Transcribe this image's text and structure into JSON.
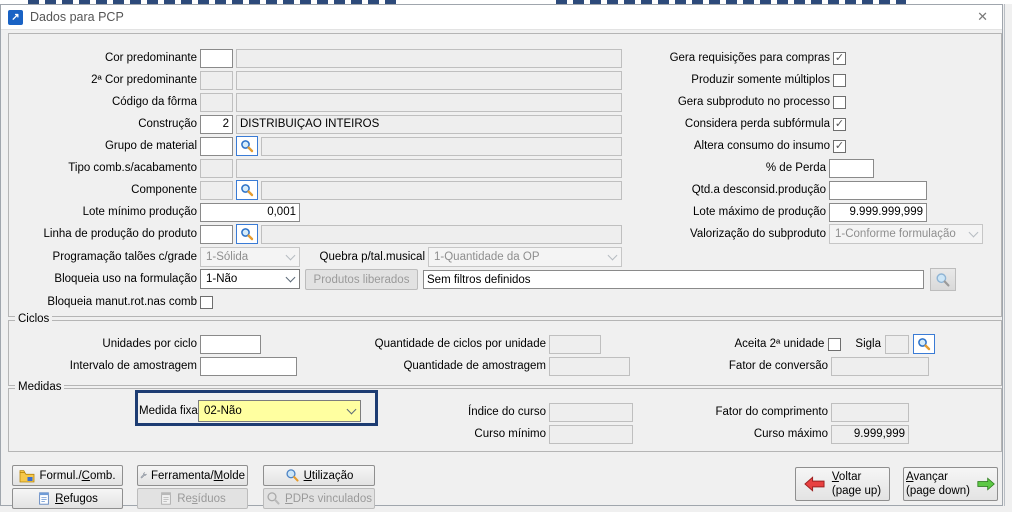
{
  "colors": {
    "focus_border": "#1d3c72",
    "highlight_field": "#ffffa0",
    "back_arrow": "#e23b3b",
    "forward_arrow": "#5cc844",
    "lookup_icon": "#2b71c8"
  },
  "titlebar": {
    "title": "Dados para PCP",
    "close_glyph": "✕"
  },
  "left": {
    "cor_predominante": {
      "label": "Cor predominante",
      "code": "",
      "desc": ""
    },
    "segunda_cor": {
      "label": "2ª Cor predominante",
      "code": "",
      "desc": ""
    },
    "codigo_forma": {
      "label": "Código da fôrma",
      "code": "",
      "desc": ""
    },
    "construcao": {
      "label": "Construção",
      "code": "2",
      "desc": "DISTRIBUIÇÃO INTEIROS"
    },
    "grupo_material": {
      "label": "Grupo de material",
      "code": "",
      "desc": ""
    },
    "tipo_comb": {
      "label": "Tipo comb.s/acabamento",
      "code": "",
      "desc": ""
    },
    "componente": {
      "label": "Componente",
      "code": "",
      "desc": ""
    },
    "lote_minimo": {
      "label": "Lote mínimo produção",
      "value": "0,001"
    },
    "linha_producao": {
      "label": "Linha de produção do produto",
      "code": "",
      "desc": ""
    },
    "programacao_taloes": {
      "label": "Programação talões c/grade",
      "value": "1-Sólida"
    },
    "quebra": {
      "label": "Quebra p/tal.musical",
      "value": "1-Quantidade da OP"
    },
    "bloqueia_uso": {
      "label": "Bloqueia uso na formulação",
      "value": "1-Não"
    },
    "produtos_liberados": {
      "button": "Produtos liberados",
      "filter": "Sem filtros definidos"
    },
    "bloqueia_manut": {
      "label": "Bloqueia manut.rot.nas comb",
      "checked": false
    }
  },
  "right": {
    "gera_requisicoes": {
      "label": "Gera requisições para compras",
      "checked": true
    },
    "produzir_multiplos": {
      "label": "Produzir somente múltiplos",
      "checked": false
    },
    "gera_subproduto": {
      "label": "Gera subproduto no processo",
      "checked": false
    },
    "considera_perda": {
      "label": "Considera perda subfórmula",
      "checked": true
    },
    "altera_consumo": {
      "label": "Altera consumo do insumo",
      "checked": true
    },
    "perc_perda": {
      "label": "% de Perda",
      "value": ""
    },
    "qtd_desconsid": {
      "label": "Qtd.a desconsid.produção",
      "value": ""
    },
    "lote_maximo": {
      "label": "Lote máximo de produção",
      "value": "9.999.999,999"
    },
    "valorizacao": {
      "label": "Valorização do subproduto",
      "value": "1-Conforme formulação"
    }
  },
  "ciclos": {
    "legend": "Ciclos",
    "unidades_ciclo": {
      "label": "Unidades por ciclo",
      "value": ""
    },
    "intervalo": {
      "label": "Intervalo de amostragem",
      "value": ""
    },
    "qtd_ciclos": {
      "label": "Quantidade de ciclos por unidade",
      "value": ""
    },
    "qtd_amostragem": {
      "label": "Quantidade de amostragem",
      "value": ""
    },
    "aceita_unidade": {
      "label": "Aceita 2ª unidade",
      "checked": false
    },
    "sigla": {
      "label": "Sigla",
      "value": ""
    },
    "fator_conversao": {
      "label": "Fator de conversão",
      "value": ""
    }
  },
  "medidas": {
    "legend": "Medidas",
    "medida_fixa": {
      "label": "Medida fixa",
      "value": "02-Não"
    },
    "indice_curso": {
      "label": "Índice do curso",
      "value": ""
    },
    "curso_minimo": {
      "label": "Curso mínimo",
      "value": ""
    },
    "fator_comprimento": {
      "label": "Fator do comprimento",
      "value": ""
    },
    "curso_maximo": {
      "label": "Curso máximo",
      "value": "9.999,999"
    }
  },
  "buttons": {
    "formul": {
      "pre": "Formul./",
      "key": "C",
      "post": "omb."
    },
    "ferramenta": {
      "pre": "Ferramenta/",
      "key": "M",
      "post": "olde"
    },
    "utilizacao": {
      "pre": "",
      "key": "U",
      "post": "tilização"
    },
    "refugos": {
      "pre": "",
      "key": "R",
      "post": "efugos"
    },
    "residuos": {
      "pre": "Re",
      "key": "s",
      "post": "íduos"
    },
    "pdps": {
      "pre": "",
      "key": "P",
      "post": "DPs vinculados"
    },
    "voltar": {
      "key": "V",
      "post": "oltar",
      "line2": "(page up)"
    },
    "avancar": {
      "key": "A",
      "post": "vançar",
      "line2": "(page down)"
    }
  }
}
